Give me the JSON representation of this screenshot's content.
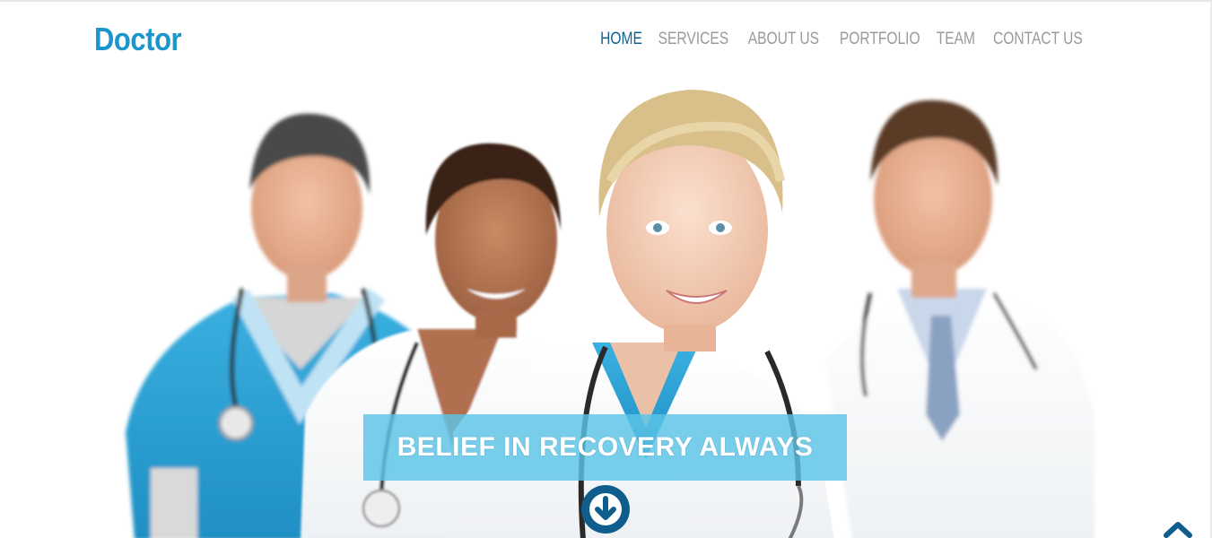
{
  "brand": {
    "logo_text": "Doctor",
    "accent_color": "#1a96cc",
    "dark_color": "#0f5d8c"
  },
  "nav": {
    "items": [
      {
        "label": "HOME",
        "active": true
      },
      {
        "label": "SERVICES",
        "active": false
      },
      {
        "label": "ABOUT US",
        "active": false
      },
      {
        "label": "PORTFOLIO",
        "active": false
      },
      {
        "label": "TEAM",
        "active": false
      },
      {
        "label": "CONTACT US",
        "active": false
      }
    ]
  },
  "hero": {
    "image_subject": "medical-team-photo",
    "banner_text": "BELIEF IN RECOVERY ALWAYS",
    "scroll_down_icon": "arrow-down-circle-icon",
    "back_to_top_icon": "chevron-up-icon"
  }
}
